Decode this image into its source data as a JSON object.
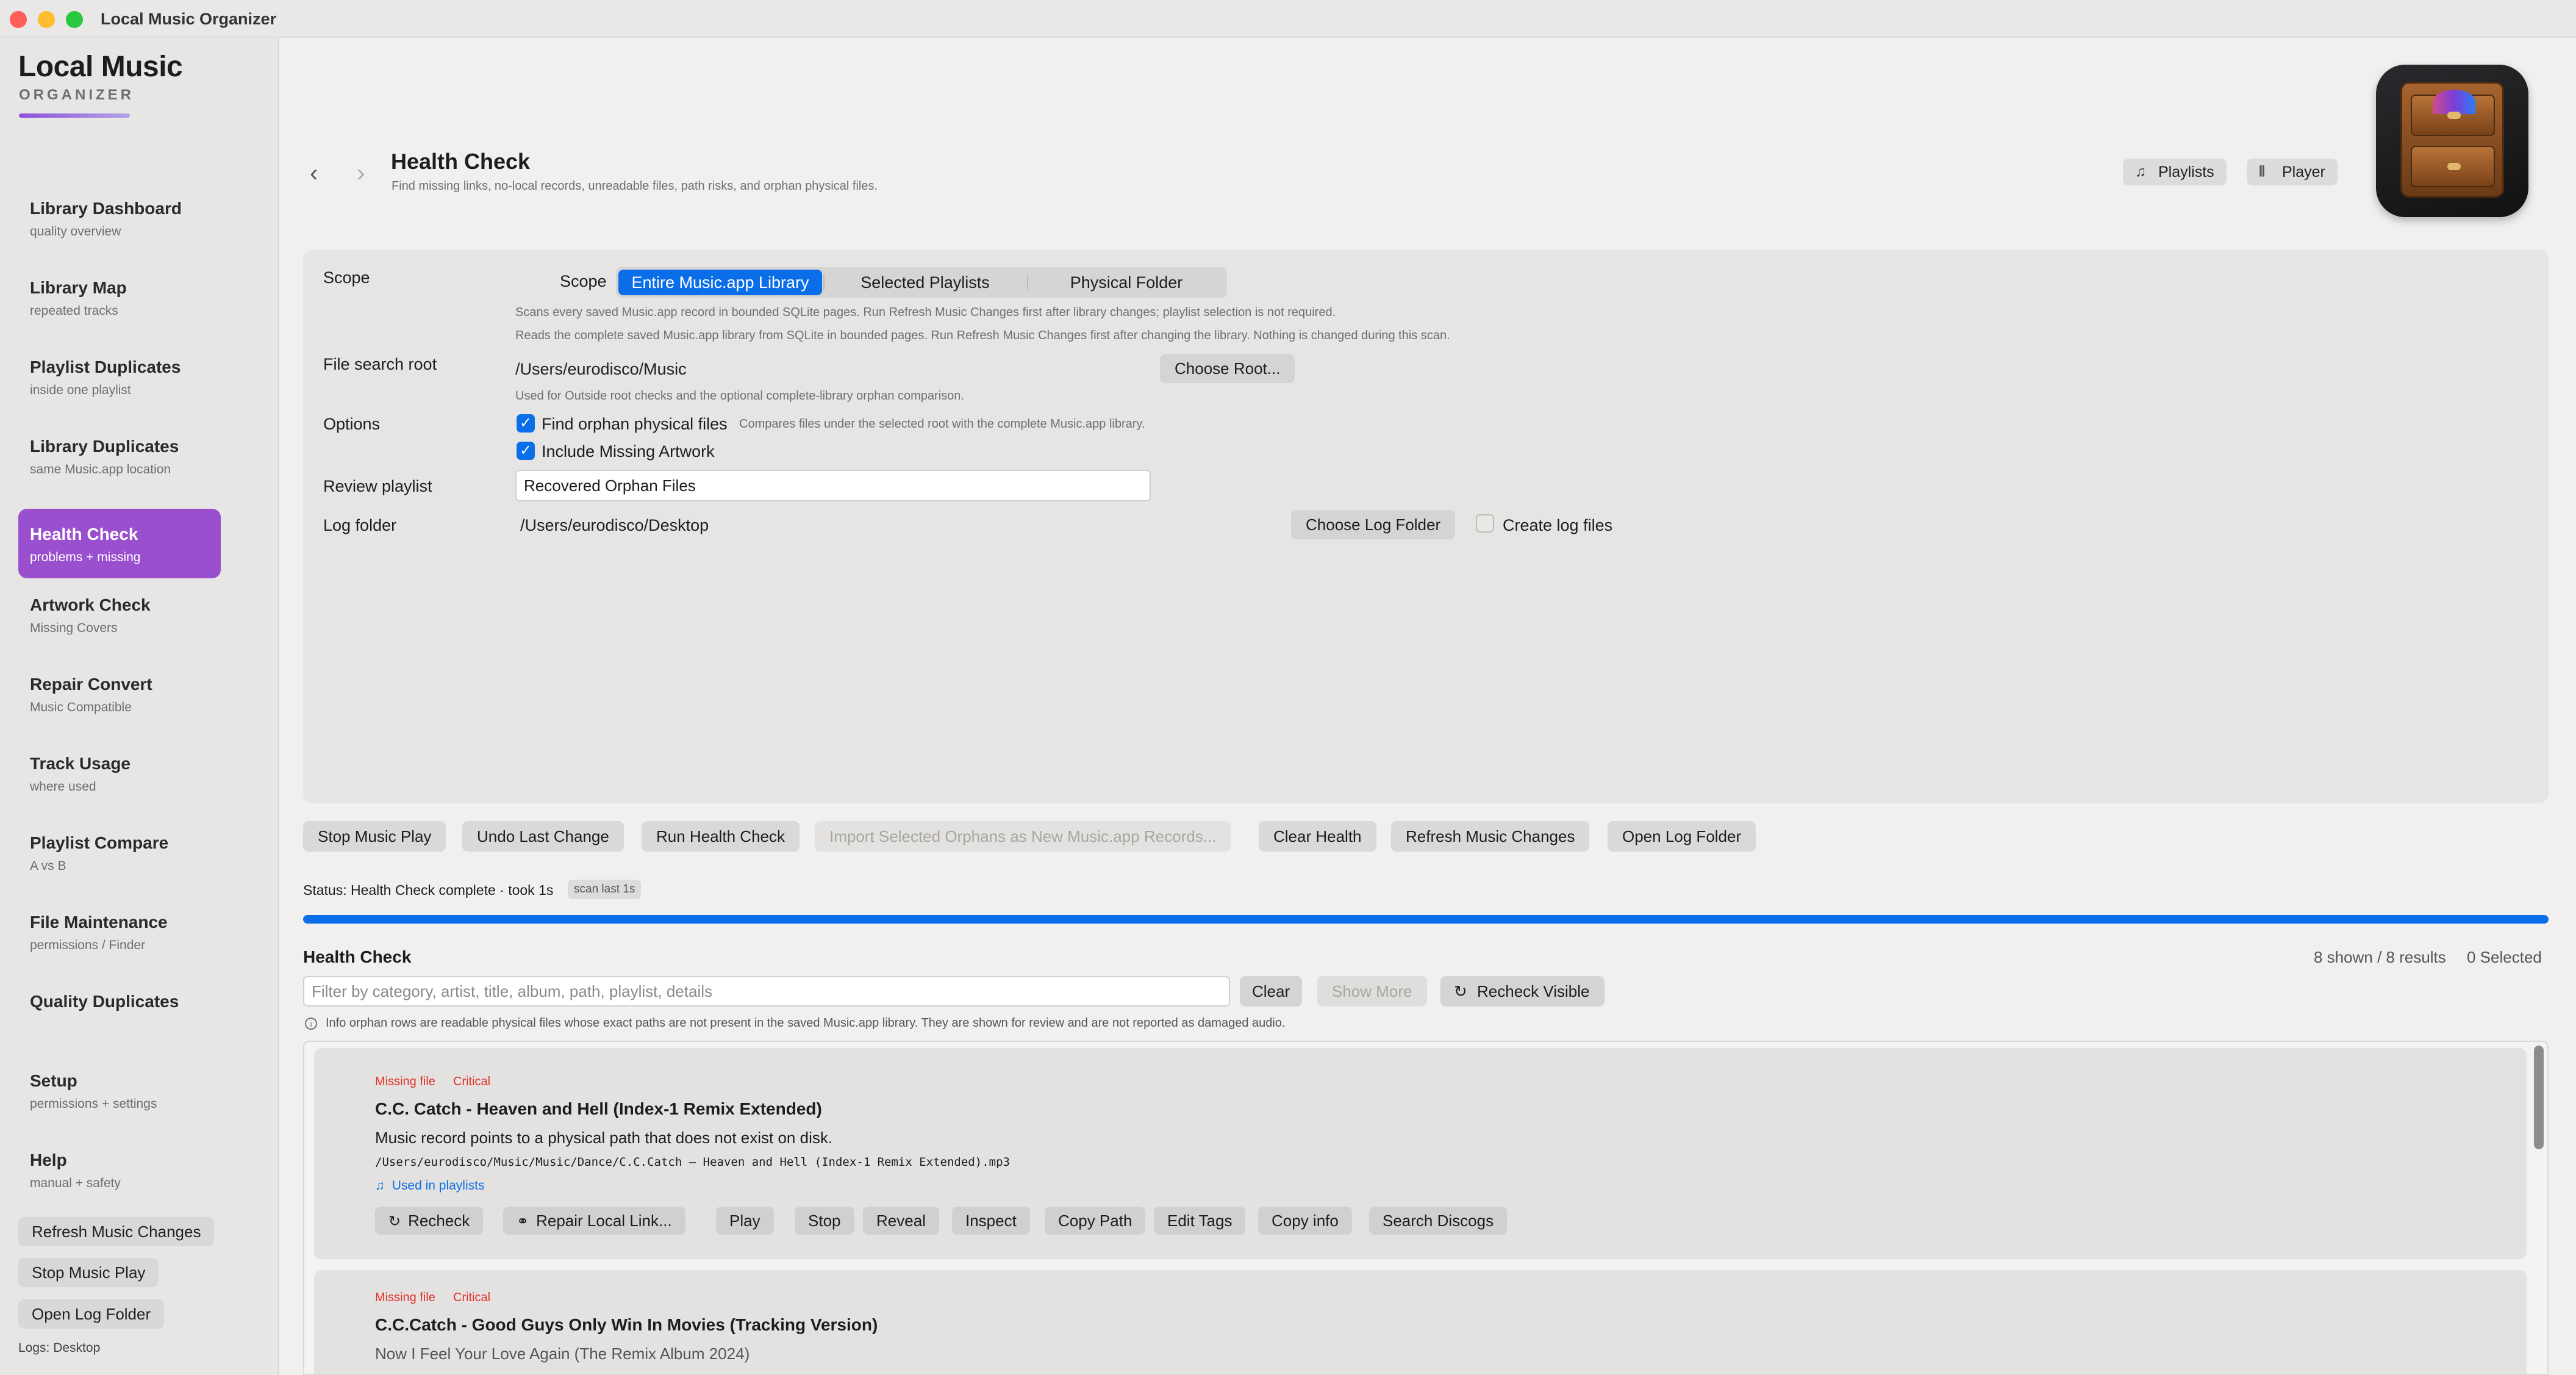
{
  "window": {
    "title": "Local Music Organizer"
  },
  "brand": {
    "title": "Local Music",
    "subtitle": "ORGANIZER"
  },
  "sidebar": {
    "items": [
      {
        "label": "Library Dashboard",
        "sub": "quality overview"
      },
      {
        "label": "Library Map",
        "sub": "repeated tracks"
      },
      {
        "label": "Playlist Duplicates",
        "sub": "inside one playlist"
      },
      {
        "label": "Library Duplicates",
        "sub": "same Music.app location"
      },
      {
        "label": "Health Check",
        "sub": "problems + missing"
      },
      {
        "label": "Artwork Check",
        "sub": "Missing Covers"
      },
      {
        "label": "Repair Convert",
        "sub": "Music Compatible"
      },
      {
        "label": "Track Usage",
        "sub": "where used"
      },
      {
        "label": "Playlist Compare",
        "sub": "A vs B"
      },
      {
        "label": "File Maintenance",
        "sub": "permissions / Finder"
      },
      {
        "label": "Quality Duplicates",
        "sub": ""
      },
      {
        "label": "Setup",
        "sub": "permissions + settings"
      },
      {
        "label": "Help",
        "sub": "manual + safety"
      }
    ],
    "buttons": {
      "refresh": "Refresh Music Changes",
      "stop": "Stop Music Play",
      "open_log": "Open Log Folder"
    },
    "logs_label": "Logs: Desktop"
  },
  "header": {
    "title": "Health Check",
    "subtitle": "Find missing links, no-local records, unreadable files, path risks, and orphan physical files.",
    "playlists_btn": "Playlists",
    "player_btn": "Player"
  },
  "scope": {
    "label": "Scope",
    "inline_label": "Scope",
    "options": [
      "Entire Music.app Library",
      "Selected Playlists",
      "Physical Folder"
    ],
    "selected": "Entire Music.app Library",
    "note1": "Scans every saved Music.app record in bounded SQLite pages. Run Refresh Music Changes first after library changes; playlist selection is not required.",
    "note2": "Reads the complete saved Music.app library from SQLite in bounded pages. Run Refresh Music Changes first after changing the library. Nothing is changed during this scan."
  },
  "file_root": {
    "label": "File search root",
    "value": "/Users/eurodisco/Music",
    "button": "Choose Root...",
    "note": "Used for Outside root checks and the optional complete-library orphan comparison."
  },
  "options": {
    "label": "Options",
    "orphan": {
      "label": "Find orphan physical files",
      "note": "Compares files under the selected root with the complete Music.app library."
    },
    "artwork": {
      "label": "Include Missing Artwork"
    }
  },
  "review": {
    "label": "Review playlist",
    "value": "Recovered Orphan Files"
  },
  "log_folder": {
    "label": "Log folder",
    "value": "/Users/eurodisco/Desktop",
    "button": "Choose Log Folder",
    "create_label": "Create log files"
  },
  "actions": {
    "stop": "Stop Music Play",
    "undo": "Undo Last Change",
    "run": "Run Health Check",
    "import": "Import Selected Orphans as New Music.app Records...",
    "clear": "Clear Health",
    "refresh": "Refresh Music Changes",
    "open_log": "Open Log Folder"
  },
  "status": {
    "text": "Status: Health Check complete · took 1s",
    "badge": "scan last 1s",
    "progress": 1.0
  },
  "results": {
    "title": "Health Check",
    "counts": "8 shown / 8 results",
    "selected": "0 Selected",
    "filter_placeholder": "Filter by category, artist, title, album, path, playlist, details",
    "clear": "Clear",
    "show_more": "Show More",
    "recheck_visible": "Recheck Visible",
    "info": "Info orphan rows are readable physical files whose exact paths are not present in the saved Music.app library. They are shown for review and are not reported as damaged audio.",
    "rows": [
      {
        "kind": "Missing file",
        "severity": "Critical",
        "title": "C.C. Catch - Heaven and Hell (Index-1 Remix Extended)",
        "desc": "Music record points to a physical path that does not exist on disk.",
        "path": "/Users/eurodisco/Music/Music/Dance/C.C.Catch – Heaven and Hell (Index-1 Remix Extended).mp3",
        "link": "Used in playlists",
        "buttons": [
          "Recheck",
          "Repair Local Link...",
          "Play",
          "Stop",
          "Reveal",
          "Inspect",
          "Copy Path",
          "Edit Tags",
          "Copy info",
          "Search Discogs"
        ]
      },
      {
        "kind": "Missing file",
        "severity": "Critical",
        "title": "C.C.Catch - Good Guys Only Win In Movies (Tracking Version)",
        "desc": "Now I Feel Your Love Again (The Remix Album 2024)"
      }
    ]
  },
  "colors": {
    "accent": "#0a6ee8",
    "active_nav": "#9a4fcf",
    "critical": "#e0302a"
  }
}
